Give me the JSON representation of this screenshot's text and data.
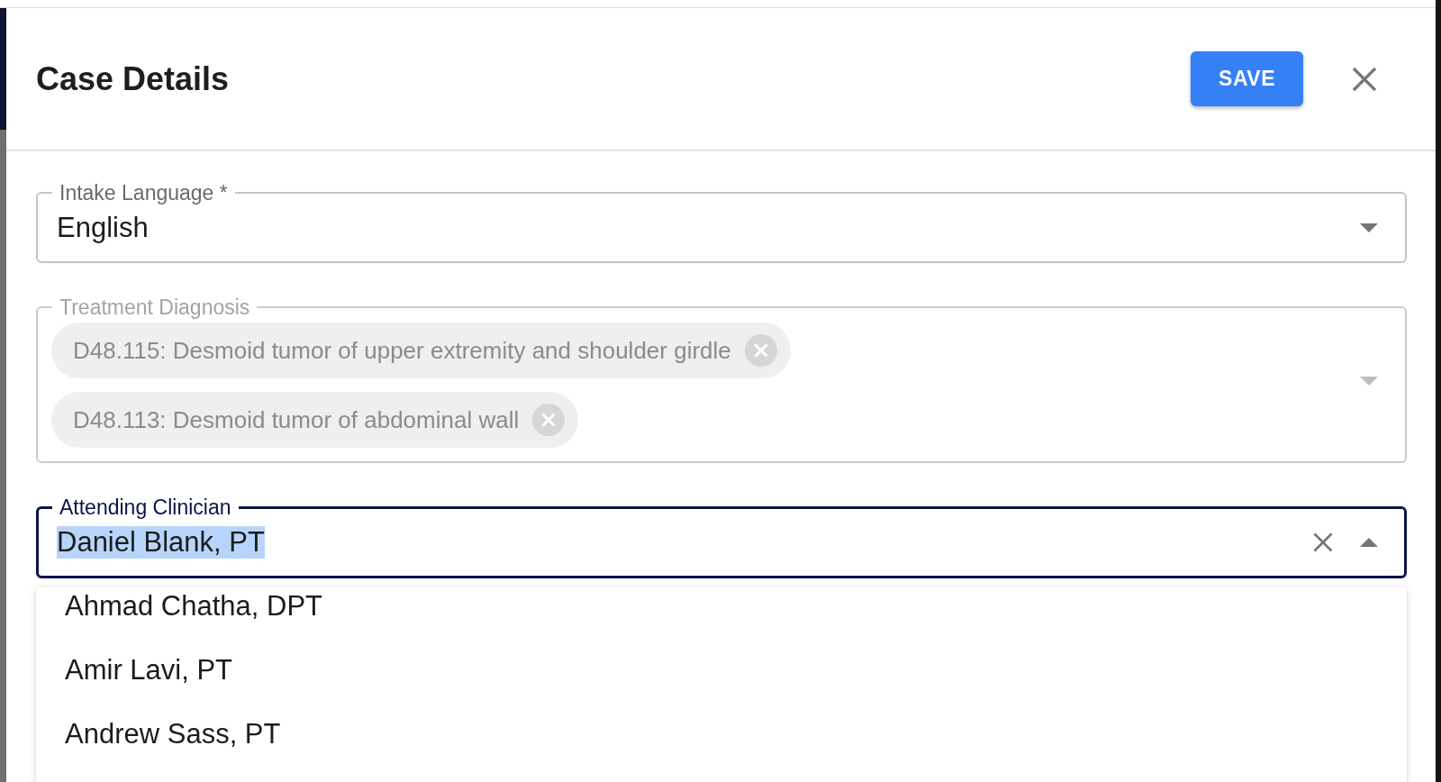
{
  "dialog": {
    "title": "Case Details",
    "save_button": {
      "label": "SAVE"
    }
  },
  "fields": [
    {
      "kind": "select",
      "label": "Intake Language *",
      "value": "English",
      "text_selected": false,
      "disabled": false,
      "focused": false,
      "open": false
    },
    {
      "kind": "multi_select",
      "label": "Treatment Diagnosis",
      "chips": [
        "D48.115: Desmoid tumor of upper extremity and shoulder girdle",
        "D48.113: Desmoid tumor of abdominal wall"
      ],
      "disabled": true,
      "focused": false,
      "open": false
    },
    {
      "kind": "autocomplete",
      "label": "Attending Clinician",
      "value": "Daniel Blank, PT",
      "text_selected": true,
      "disabled": false,
      "focused": true,
      "open": true,
      "options": [
        {
          "label": "Ahmad Chatha, DPT",
          "selected": false
        },
        {
          "label": "Amir Lavi, PT",
          "selected": false
        },
        {
          "label": "Andrew Sass, PT",
          "selected": false
        }
      ]
    }
  ]
}
